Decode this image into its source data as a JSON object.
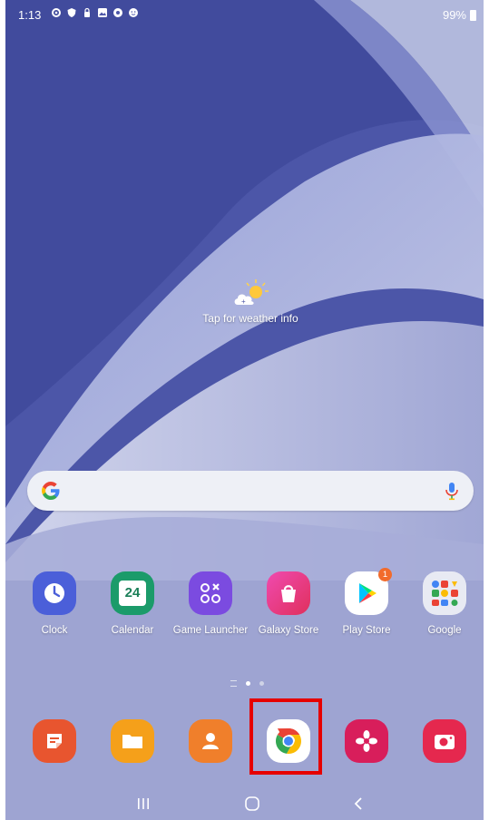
{
  "status_bar": {
    "time": "1:13",
    "left_icons": [
      "settings-gear-icon",
      "shield-icon",
      "lock-icon",
      "image-icon",
      "sync-icon",
      "face-icon"
    ],
    "battery_text": "99%"
  },
  "weather": {
    "icon": "sun-cloud-icon",
    "text": "Tap for weather info"
  },
  "search": {
    "logo": "google-g-icon",
    "mic": "mic-icon"
  },
  "apps": [
    {
      "label": "Clock",
      "icon": "clock-icon",
      "color": "#4b5fd9"
    },
    {
      "label": "Calendar",
      "icon": "calendar-icon",
      "color": "#1b9b6a",
      "day": "24"
    },
    {
      "label": "Game Launcher",
      "icon": "game-launcher-icon",
      "color": "#7b4be0"
    },
    {
      "label": "Galaxy Store",
      "icon": "galaxy-store-icon",
      "color": "#e0308a"
    },
    {
      "label": "Play Store",
      "icon": "play-store-icon",
      "color": "#ffffff",
      "badge": "1"
    },
    {
      "label": "Google",
      "icon": "google-folder-icon",
      "color": "#e8eaf3"
    }
  ],
  "dock": [
    {
      "icon": "notes-icon",
      "color": "#e8552f"
    },
    {
      "icon": "my-files-icon",
      "color": "#f5a01a"
    },
    {
      "icon": "contacts-icon",
      "color": "#f07f2b"
    },
    {
      "icon": "chrome-icon",
      "color": "#ffffff"
    },
    {
      "icon": "bixby-flower-icon",
      "color": "#d81e5b"
    },
    {
      "icon": "camera-icon",
      "color": "#e5284e"
    }
  ],
  "nav": [
    "recents-icon",
    "home-icon",
    "back-icon"
  ]
}
